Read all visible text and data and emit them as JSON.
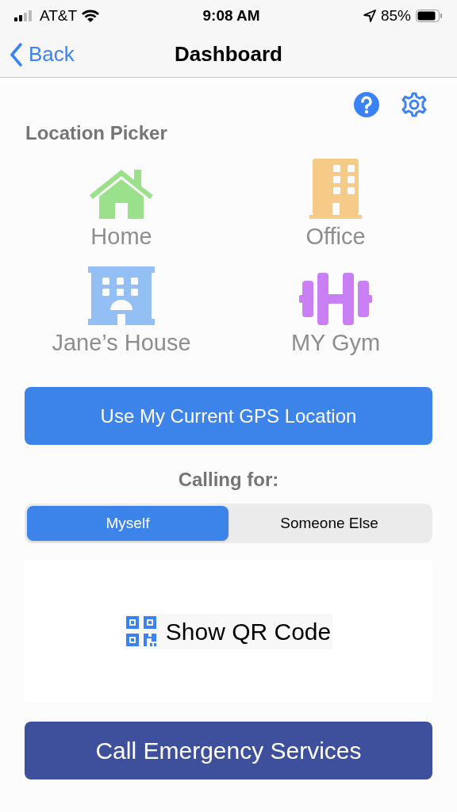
{
  "status_bar": {
    "carrier": "AT&T",
    "time": "9:08 AM",
    "battery": "85%"
  },
  "nav": {
    "back": "Back",
    "title": "Dashboard"
  },
  "section_title": "Location Picker",
  "locations": [
    {
      "kind": "house",
      "label": "Home",
      "color": "#9be08a"
    },
    {
      "kind": "office",
      "label": "Office",
      "color": "#f5cb87"
    },
    {
      "kind": "building",
      "label": "Jane’s House",
      "color": "#93bff5"
    },
    {
      "kind": "gym",
      "label": "MY Gym",
      "color": "#c980f5"
    }
  ],
  "gps_button": "Use My Current GPS Location",
  "calling_for": {
    "label": "Calling for:",
    "options": [
      {
        "label": "Myself",
        "selected": true
      },
      {
        "label": "Someone Else",
        "selected": false
      }
    ]
  },
  "qr_button": "Show QR Code",
  "emergency_button": "Call Emergency Services"
}
